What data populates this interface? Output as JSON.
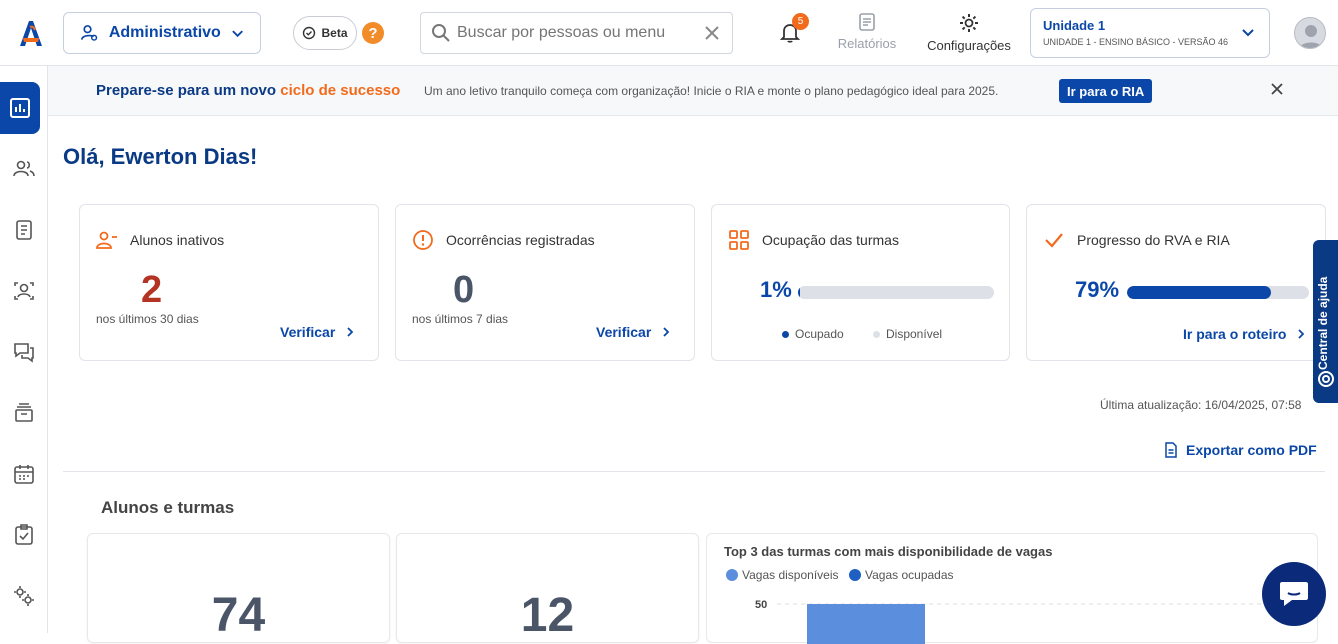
{
  "topbar": {
    "role_label": "Administrativo",
    "beta_label": "Beta",
    "help_glyph": "?",
    "search_placeholder": "Buscar por pessoas ou menu",
    "notifications_count": "5",
    "reports_label": "Relatórios",
    "settings_label": "Configurações",
    "unit_title": "Unidade 1",
    "unit_subtitle": "UNIDADE 1 - ENSINO BÁSICO - VERSÃO 46"
  },
  "banner": {
    "title_prefix": "Prepare-se para um novo ",
    "title_highlight": "ciclo de sucesso",
    "text": "Um ano letivo tranquilo começa com organização! Inicie o RIA e monte o plano pedagógico ideal para 2025.",
    "cta": "Ir para o RIA"
  },
  "greeting": "Olá, Ewerton Dias!",
  "cards": {
    "inactive": {
      "title": "Alunos inativos",
      "value": "2",
      "sub": "nos últimos 30 dias",
      "link": "Verificar"
    },
    "occurrences": {
      "title": "Ocorrências registradas",
      "value": "0",
      "sub": "nos últimos 7 dias",
      "link": "Verificar"
    },
    "occupancy": {
      "title": "Ocupação das turmas",
      "value": "1%",
      "fill": 0.01,
      "legend_occupied": "Ocupado",
      "legend_available": "Disponível"
    },
    "progress": {
      "title": "Progresso do RVA e RIA",
      "value": "79%",
      "fill": 0.79,
      "link": "Ir para o roteiro"
    }
  },
  "last_update": "Última atualização: 16/04/2025, 07:58",
  "export_label": "Exportar como PDF",
  "section_title": "Alunos e turmas",
  "summary": {
    "students": "74",
    "classes": "12"
  },
  "chart_data": {
    "type": "bar",
    "title": "Top 3 das turmas com mais disponibilidade de vagas",
    "series": [
      {
        "name": "Vagas disponíveis",
        "color": "#5b8fdd"
      },
      {
        "name": "Vagas ocupadas",
        "color": "#1f5fc4"
      }
    ],
    "visible_tick": "50",
    "ylim_visible_top": 50,
    "visible_bar_value_at_least": 50
  },
  "help_center": "Central de ajuda",
  "colors": {
    "brand": "#0b47a8",
    "accent": "#f26b1d",
    "danger": "#b33423"
  }
}
